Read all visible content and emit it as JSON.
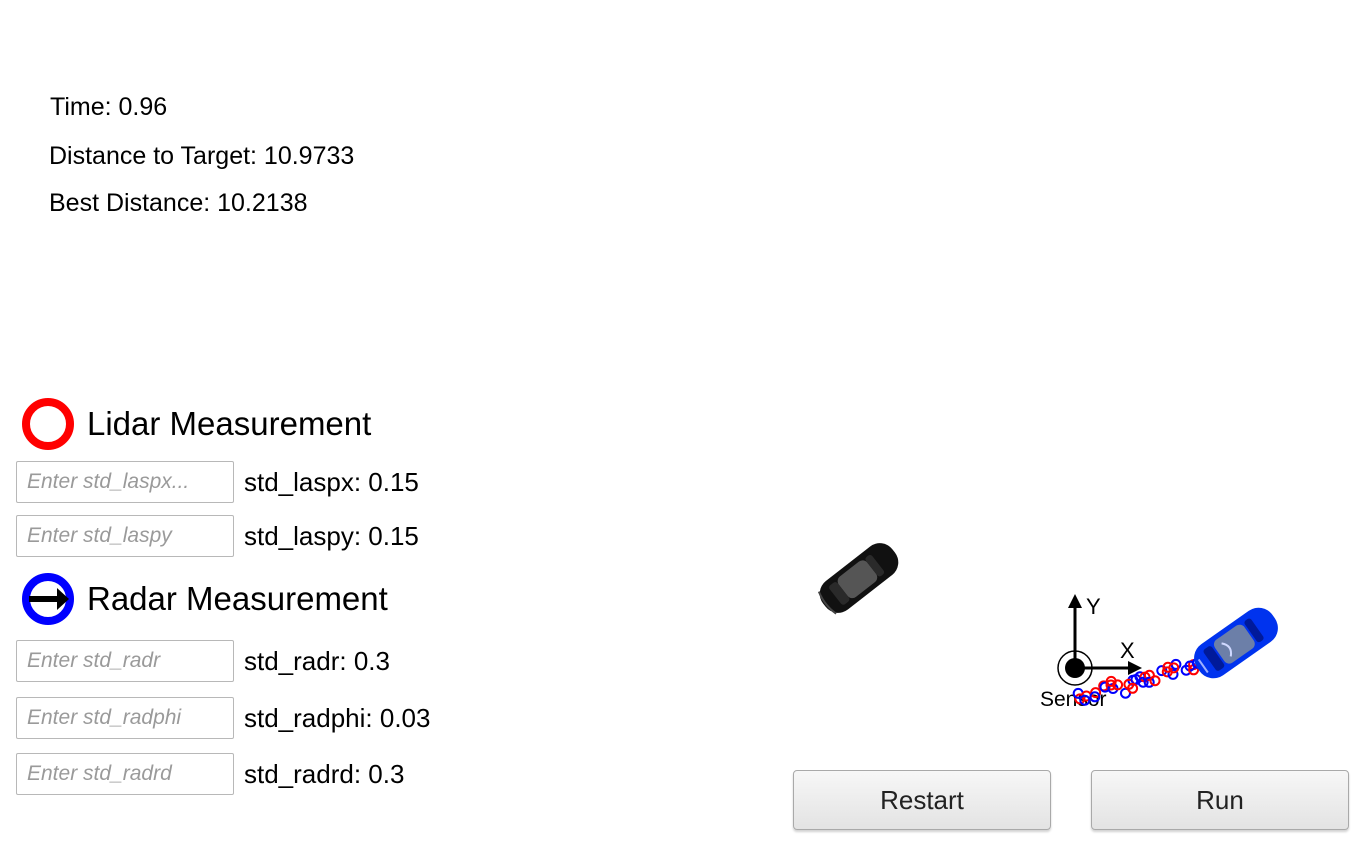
{
  "stats": {
    "time": "Time: 0.96",
    "distance": "Distance to Target: 10.9733",
    "best": "Best Distance: 10.2138"
  },
  "lidar": {
    "title": "Lidar Measurement",
    "fields": [
      {
        "placeholder": "Enter std_laspx...",
        "value_label": "std_laspx: 0.15"
      },
      {
        "placeholder": "Enter std_laspy",
        "value_label": "std_laspy: 0.15"
      }
    ]
  },
  "radar": {
    "title": "Radar Measurement",
    "fields": [
      {
        "placeholder": "Enter std_radr",
        "value_label": "std_radr: 0.3"
      },
      {
        "placeholder": "Enter std_radphi",
        "value_label": "std_radphi: 0.03"
      },
      {
        "placeholder": "Enter std_radrd",
        "value_label": "std_radrd: 0.3"
      }
    ]
  },
  "scene": {
    "axis_x": "X",
    "axis_y": "Y",
    "sensor_label": "Sensor",
    "target_car_icon": "black-car-icon",
    "estimate_car_icon": "blue-car-icon",
    "lidar_color": "#ff0000",
    "radar_color": "#0000ff"
  },
  "buttons": {
    "restart": "Restart",
    "run": "Run"
  }
}
